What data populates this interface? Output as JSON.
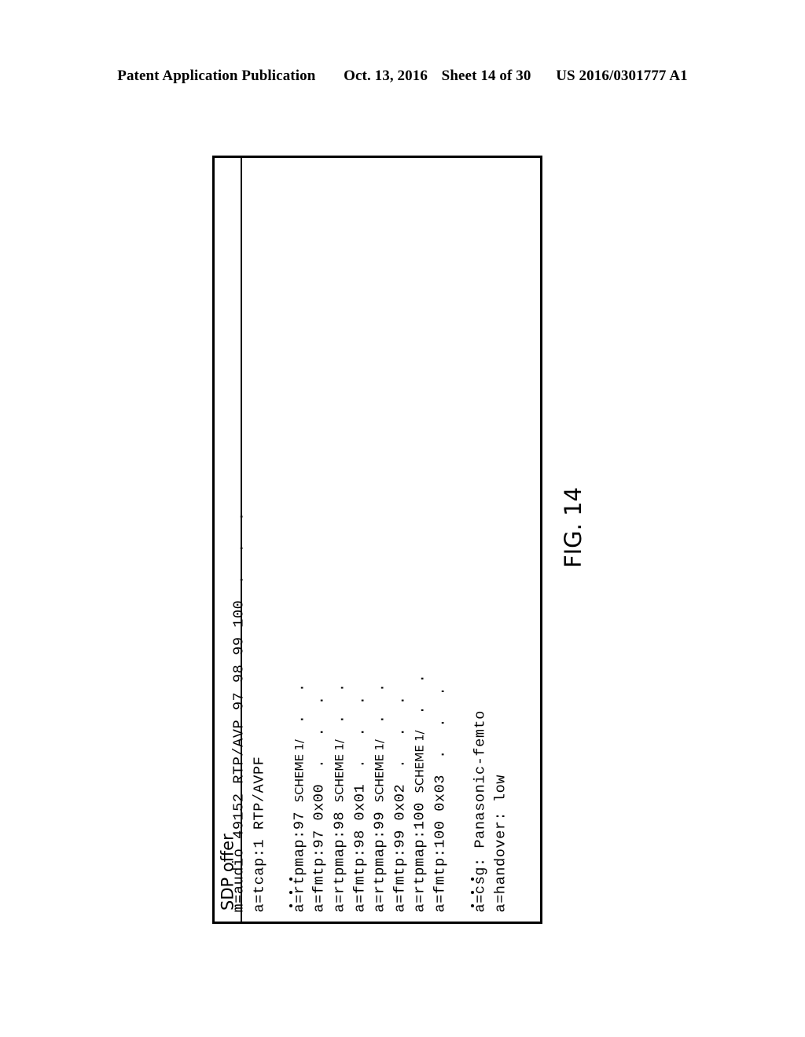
{
  "header": {
    "publication": "Patent Application Publication",
    "date": "Oct. 13, 2016",
    "sheet": "Sheet 14 of 30",
    "document_number": "US 2016/0301777 A1"
  },
  "figure": {
    "label": "FIG. 14",
    "box_title": "SDP offer",
    "lines": [
      {
        "type": "code",
        "text": "m=audio 49152 RTP/AVP 97 98 99 100",
        "scheme": "",
        "tail": "",
        "dots": " . . ."
      },
      {
        "type": "code",
        "text": "a=tcap:1 RTP/AVPF",
        "scheme": "",
        "tail": "",
        "dots": ""
      },
      {
        "type": "vdots",
        "text": ""
      },
      {
        "type": "code",
        "text": "a=rtpmap:97 ",
        "scheme": "SCHEME 1/",
        "tail": "",
        "dots": " . ."
      },
      {
        "type": "code",
        "text": "a=fmtp:97 0x00",
        "scheme": "",
        "tail": "",
        "dots": " . . ."
      },
      {
        "type": "code",
        "text": "a=rtpmap:98 ",
        "scheme": "SCHEME 1/",
        "tail": "",
        "dots": " . ."
      },
      {
        "type": "code",
        "text": "a=fmtp:98 0x01",
        "scheme": "",
        "tail": "",
        "dots": " . . ."
      },
      {
        "type": "code",
        "text": "a=rtpmap:99 ",
        "scheme": "SCHEME 1/",
        "tail": "",
        "dots": " . ."
      },
      {
        "type": "code",
        "text": "a=fmtp:99 0x02",
        "scheme": "",
        "tail": "",
        "dots": " . . ."
      },
      {
        "type": "code",
        "text": "a=rtpmap:100 ",
        "scheme": "SCHEME 1/",
        "tail": "",
        "dots": " . ."
      },
      {
        "type": "code",
        "text": "a=fmtp:100 0x03",
        "scheme": "",
        "tail": "",
        "dots": " . . ."
      },
      {
        "type": "vdots",
        "text": ""
      },
      {
        "type": "code",
        "text": "a=csg: Panasonic-femto",
        "scheme": "",
        "tail": "",
        "dots": ""
      },
      {
        "type": "code",
        "text": "a=handover: low",
        "scheme": "",
        "tail": "",
        "dots": ""
      }
    ]
  },
  "colors": {
    "ink": "#000000",
    "page": "#ffffff"
  }
}
